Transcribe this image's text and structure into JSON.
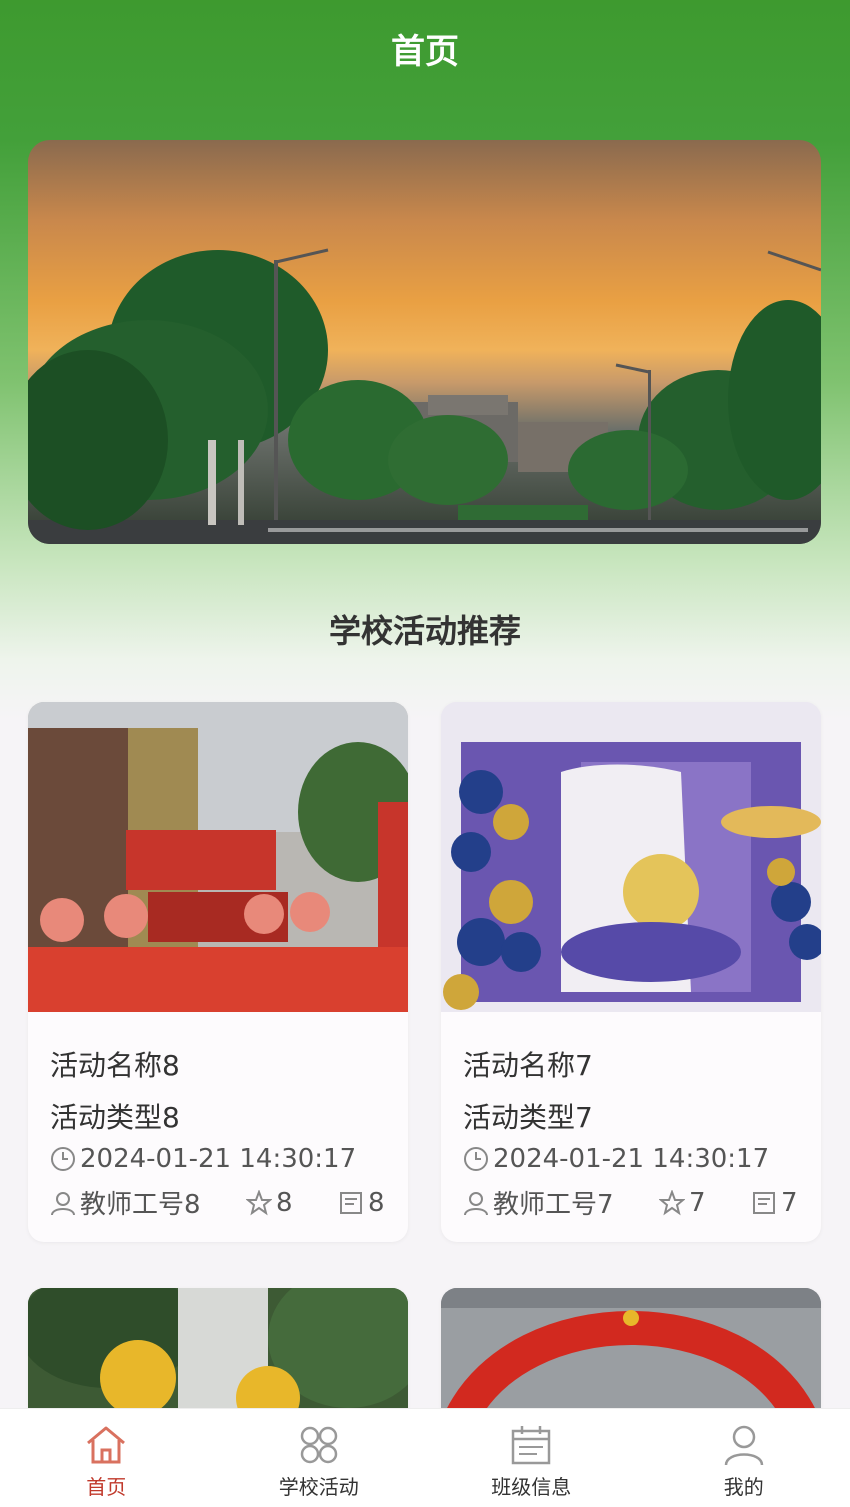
{
  "header": {
    "title": "首页"
  },
  "banner": {
    "slide_count": 3,
    "active_index": 2
  },
  "section": {
    "title": "学校活动推荐"
  },
  "activities": [
    {
      "name": "活动名称8",
      "type": "活动类型8",
      "time": "2024-01-21 14:30:17",
      "author": "教师工号8",
      "likes": "8",
      "favorites": "8"
    },
    {
      "name": "活动名称7",
      "type": "活动类型7",
      "time": "2024-01-21 14:30:17",
      "author": "教师工号7",
      "likes": "7",
      "favorites": "7"
    }
  ],
  "nav": {
    "items": [
      {
        "label": "首页",
        "icon": "home-icon",
        "active": true
      },
      {
        "label": "学校活动",
        "icon": "grid-icon",
        "active": false
      },
      {
        "label": "班级信息",
        "icon": "calendar-icon",
        "active": false
      },
      {
        "label": "我的",
        "icon": "user-icon",
        "active": false
      }
    ]
  },
  "colors": {
    "primary": "#43a03a",
    "active_tab": "#c0392b",
    "dot_active": "#3fae2a"
  }
}
